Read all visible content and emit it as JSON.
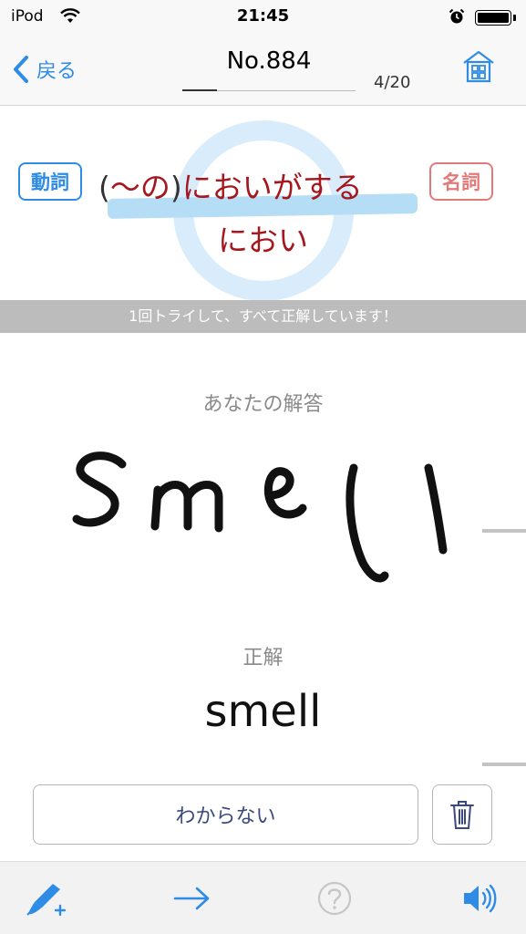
{
  "status_bar": {
    "device": "iPod",
    "time": "21:45"
  },
  "nav": {
    "back_label": "戻る",
    "title": "No.884",
    "count": "4/20",
    "progress": 0.2
  },
  "question": {
    "verb_tag": "動詞",
    "noun_tag": "名詞",
    "verb_prefix": "(",
    "verb_tilde": "〜の",
    "verb_suffix": ")",
    "verb_meaning": "においがする",
    "noun_meaning": "におい"
  },
  "info_bar": {
    "text": "1回トライして、すべて正解しています！"
  },
  "answer": {
    "your_answer_label": "あなたの解答",
    "correct_label": "正解",
    "correct_word": "smell",
    "dont_know_label": "わからない"
  },
  "colors": {
    "accent": "#2f8ce6",
    "meaning_red": "#a5171d",
    "noun_tag": "#e27a7a",
    "ring": "#d8ecfb"
  },
  "icons": [
    "wifi-icon",
    "alarm-icon",
    "battery-icon",
    "chevron-left-icon",
    "home-grid-icon",
    "trash-icon",
    "pen-add-icon",
    "arrow-right-icon",
    "help-icon",
    "speaker-icon"
  ]
}
